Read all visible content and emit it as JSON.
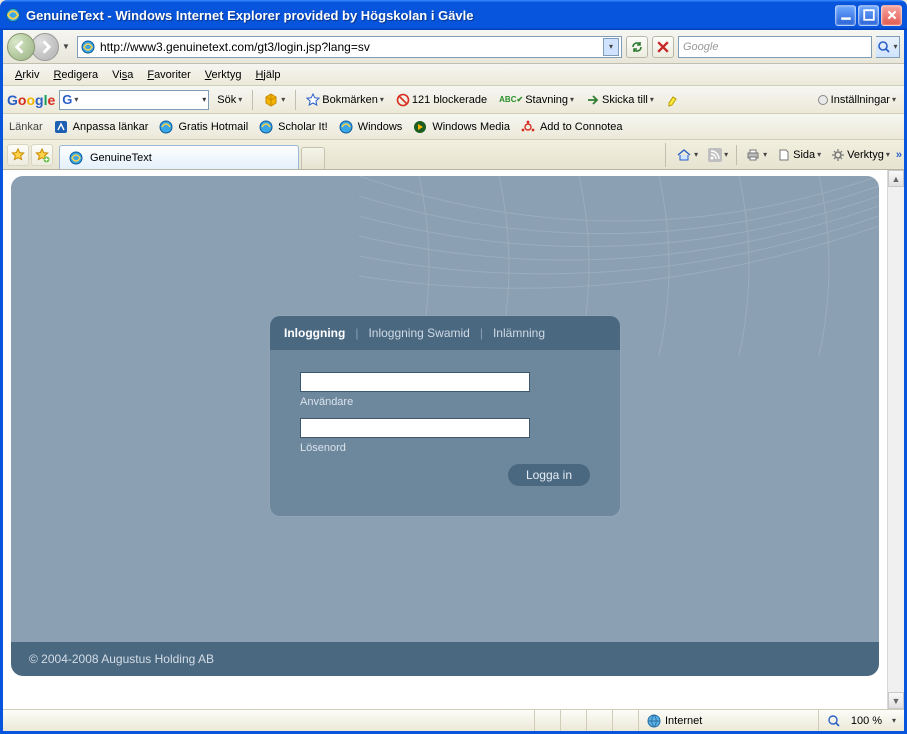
{
  "window": {
    "title": "GenuineText - Windows Internet Explorer provided by Högskolan i Gävle"
  },
  "address": {
    "url": "http://www3.genuinetext.com/gt3/login.jsp?lang=sv"
  },
  "search": {
    "placeholder": "Google"
  },
  "menu": {
    "arkiv_u": "A",
    "arkiv_rest": "rkiv",
    "redigera_u": "R",
    "redigera_rest": "edigera",
    "visa_pre": "Vi",
    "visa_u": "s",
    "visa_rest": "a",
    "favoriter_u": "F",
    "favoriter_rest": "avoriter",
    "verktyg_u": "V",
    "verktyg_rest": "erktyg",
    "hjalp_u": "H",
    "hjalp_rest": "jälp"
  },
  "gtoolbar": {
    "sok": "Sök",
    "bokmarken": "Bokmärken",
    "blockerade": "121 blockerade",
    "stavning": "Stavning",
    "skicka": "Skicka till",
    "installningar": "Inställningar"
  },
  "linksbar": {
    "label": "Länkar",
    "anpassa": "Anpassa länkar",
    "hotmail": "Gratis Hotmail",
    "scholar": "Scholar It!",
    "windows": "Windows",
    "media": "Windows Media",
    "connotea": "Add to Connotea"
  },
  "tab": {
    "title": "GenuineText"
  },
  "tabtools": {
    "sida": "Sida",
    "verktyg": "Verktyg"
  },
  "login": {
    "tab1": "Inloggning",
    "tab2": "Inloggning Swamid",
    "tab3": "Inlämning",
    "user_label": "Användare",
    "pass_label": "Lösenord",
    "submit": "Logga in"
  },
  "page": {
    "copyright": "© 2004-2008 Augustus Holding AB"
  },
  "status": {
    "zone": "Internet",
    "zoom": "100 %"
  }
}
